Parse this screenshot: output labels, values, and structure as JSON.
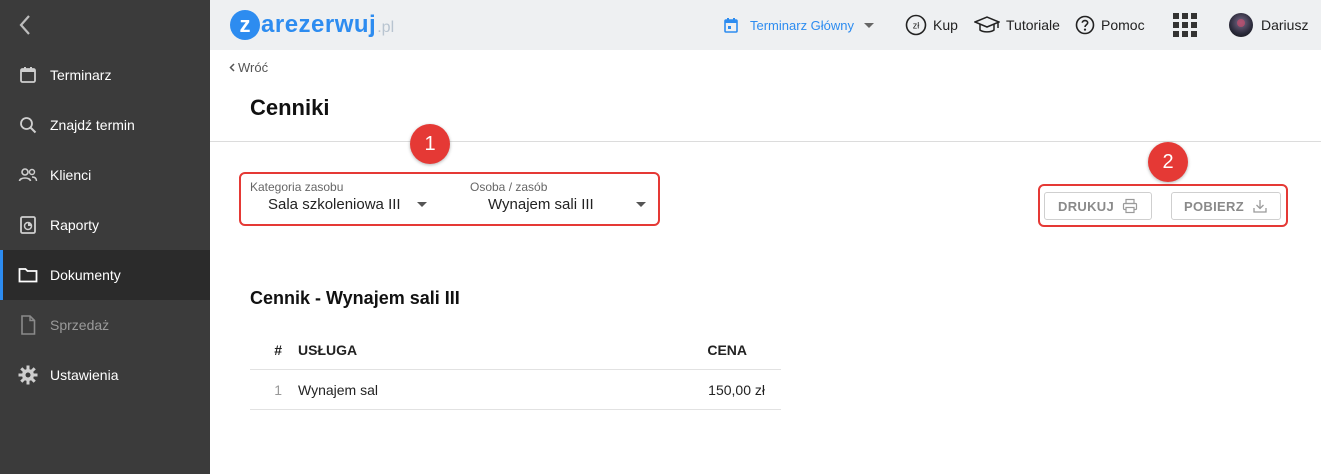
{
  "sidebar": {
    "items": [
      {
        "label": "Terminarz",
        "icon": "calendar-icon"
      },
      {
        "label": "Znajdź termin",
        "icon": "search-icon"
      },
      {
        "label": "Klienci",
        "icon": "users-icon"
      },
      {
        "label": "Raporty",
        "icon": "report-icon"
      },
      {
        "label": "Dokumenty",
        "icon": "folder-icon",
        "active": true
      },
      {
        "label": "Sprzedaż",
        "icon": "file-icon",
        "disabled": true
      },
      {
        "label": "Ustawienia",
        "icon": "gear-icon"
      }
    ]
  },
  "topbar": {
    "logo_z": "z",
    "logo_text": "arezerwuj",
    "logo_suffix": ".pl",
    "calendar_label": "Terminarz Główny",
    "buy_label": "Kup",
    "buy_icon_text": "zł",
    "tutorials_label": "Tutoriale",
    "help_label": "Pomoc",
    "user_name": "Dariusz"
  },
  "page": {
    "back_label": "Wróć",
    "title": "Cenniki"
  },
  "filters": {
    "category_label": "Kategoria zasobu",
    "category_value": "Sala szkoleniowa III",
    "resource_label": "Osoba / zasób",
    "resource_value": "Wynajem sali III"
  },
  "badges": {
    "one": "1",
    "two": "2"
  },
  "actions": {
    "print_label": "DRUKUJ",
    "download_label": "POBIERZ"
  },
  "pricelist": {
    "title": "Cennik - Wynajem sali III",
    "headers": {
      "num": "#",
      "service": "USŁUGA",
      "price": "CENA"
    },
    "rows": [
      {
        "num": "1",
        "service": "Wynajem sal",
        "price": "150,00 zł"
      }
    ]
  },
  "colors": {
    "accent": "#2d8cf0",
    "sidebar_bg": "#3b3b3b",
    "highlight": "#e53935"
  }
}
